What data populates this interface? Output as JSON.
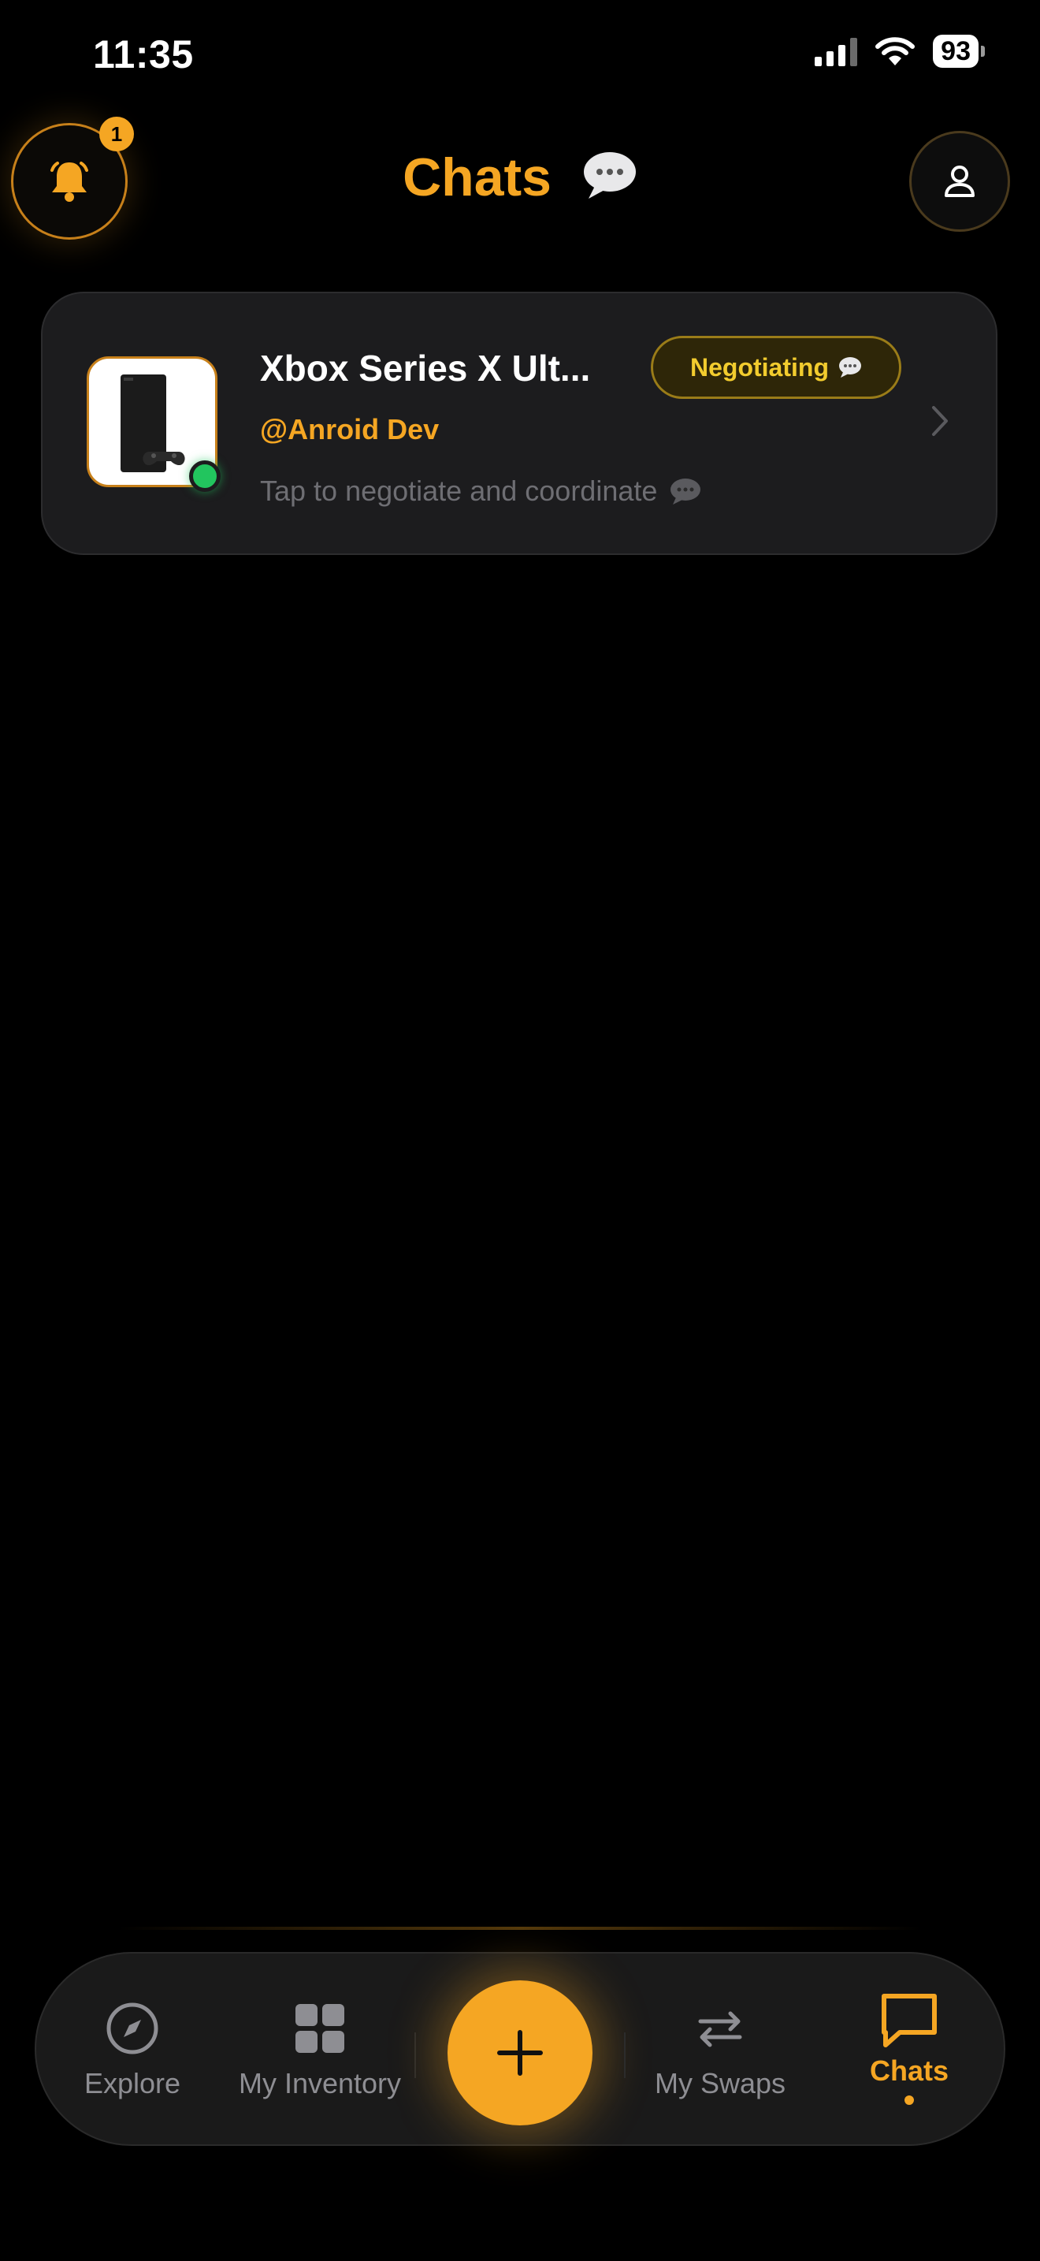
{
  "status_bar": {
    "time": "11:35",
    "battery": "93"
  },
  "header": {
    "title": "Chats",
    "notification_count": "1"
  },
  "chats": [
    {
      "title": "Xbox Series X Ult...",
      "status": "Negotiating",
      "user": "@Anroid Dev",
      "preview": "Tap to negotiate and coordinate",
      "online": true
    }
  ],
  "bottom_nav": {
    "items": [
      {
        "label": "Explore",
        "icon": "compass-icon"
      },
      {
        "label": "My Inventory",
        "icon": "grid-icon"
      },
      {
        "label": "My Swaps",
        "icon": "swap-arrows-icon"
      },
      {
        "label": "Chats",
        "icon": "chat-bubble-icon",
        "active": true
      }
    ]
  },
  "colors": {
    "accent": "#f5a623",
    "online": "#22c55e",
    "status_pill": "#f2cc2e",
    "background": "#000000"
  }
}
